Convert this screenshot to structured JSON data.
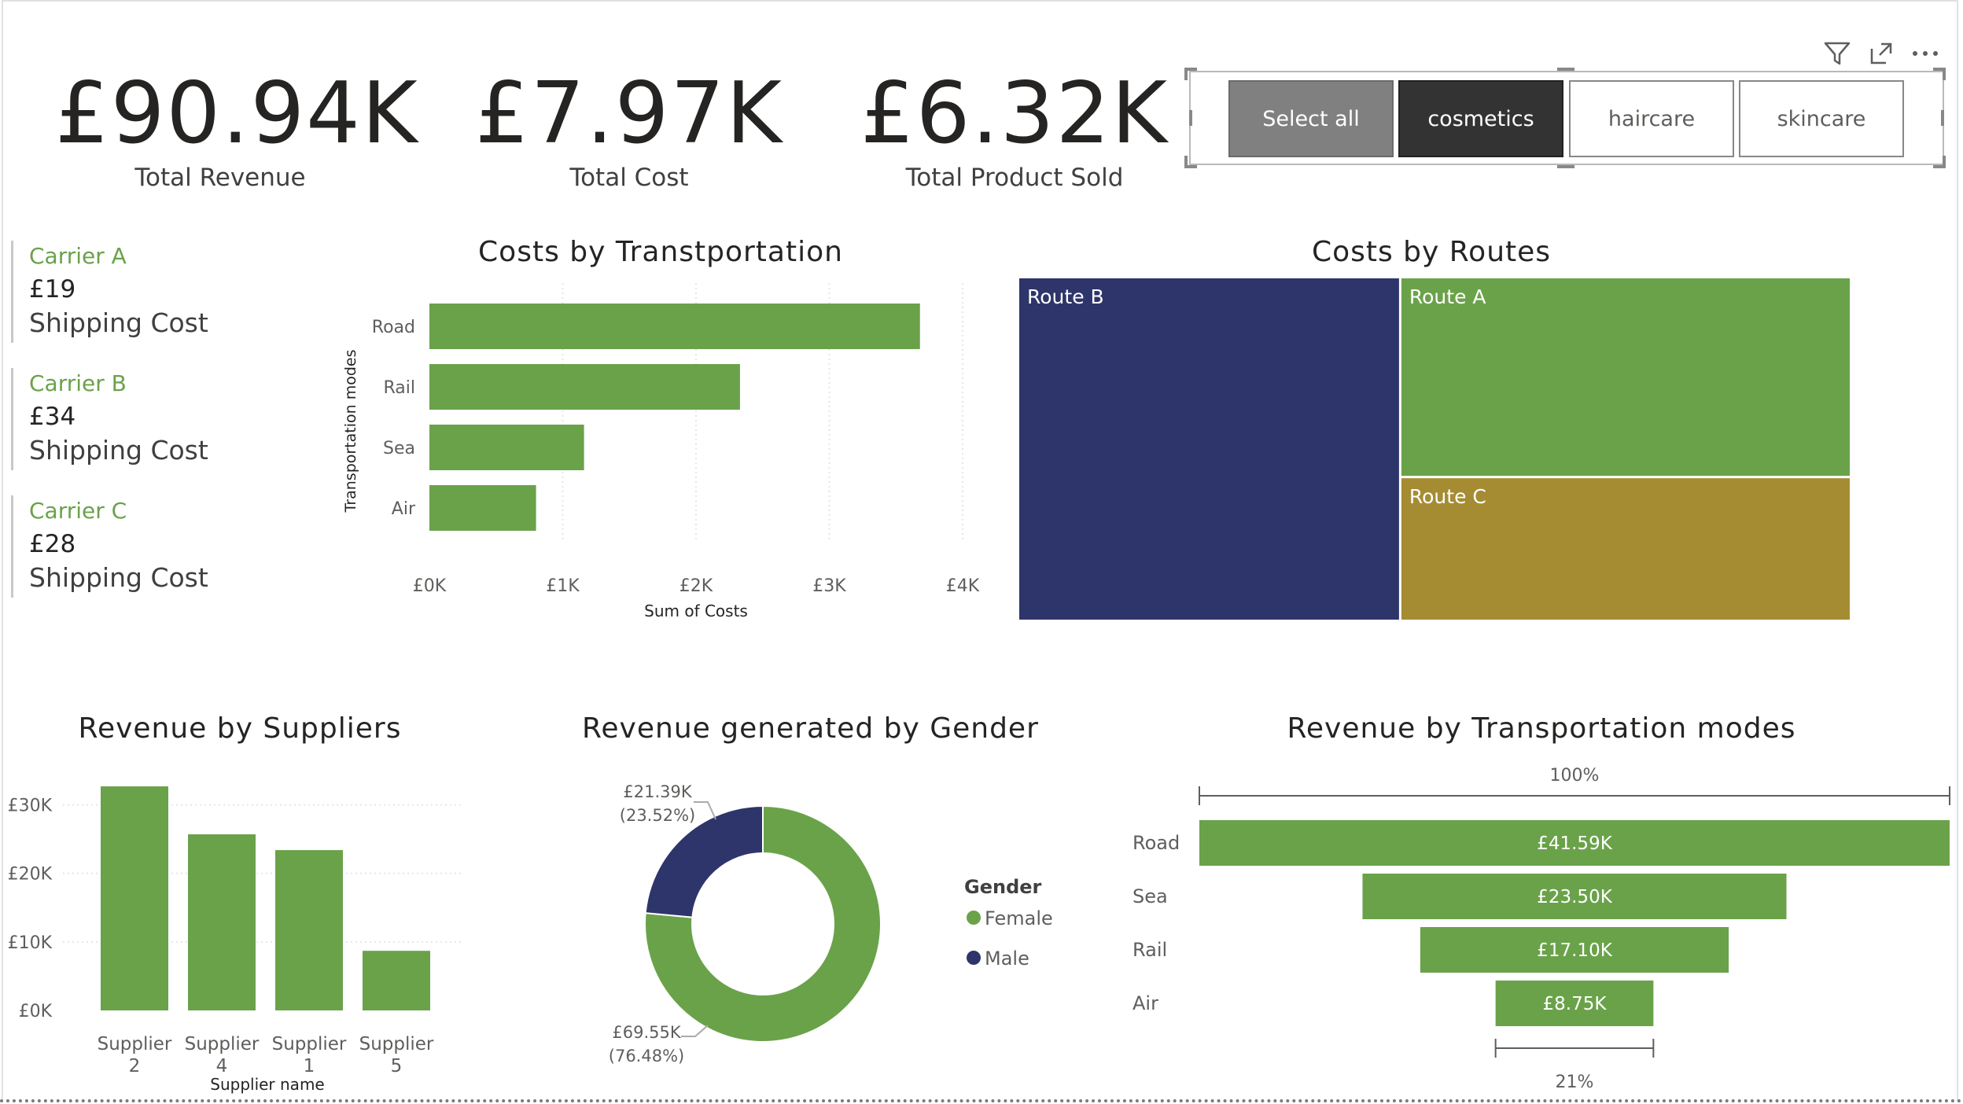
{
  "kpis": [
    {
      "value": "£90.94K",
      "label": "Total Revenue"
    },
    {
      "value": "£7.97K",
      "label": "Total Cost"
    },
    {
      "value": "£6.32K",
      "label": "Total Product Sold"
    }
  ],
  "slicer": {
    "options": [
      "Select all",
      "cosmetics",
      "haircare",
      "skincare"
    ],
    "selected": "cosmetics"
  },
  "header_icons": [
    "filter-icon",
    "focus-mode-icon",
    "more-options-icon"
  ],
  "carriers": [
    {
      "name": "Carrier A",
      "cost": "£19",
      "label": "Shipping Cost"
    },
    {
      "name": "Carrier B",
      "cost": "£34",
      "label": "Shipping Cost"
    },
    {
      "name": "Carrier C",
      "cost": "£28",
      "label": "Shipping Cost"
    }
  ],
  "colors": {
    "green": "#6aa24a",
    "navy": "#2e356b",
    "gold": "#a58c33",
    "text": "#252423"
  },
  "chart_data": [
    {
      "id": "costs-by-transportation",
      "type": "bar",
      "orientation": "horizontal",
      "title": "Costs by Transtportation",
      "xlabel": "Sum of Costs",
      "ylabel": "Transportation modes",
      "categories": [
        "Road",
        "Rail",
        "Sea",
        "Air"
      ],
      "values": [
        3680,
        2330,
        1160,
        800
      ],
      "xticks": [
        "£0K",
        "£1K",
        "£2K",
        "£3K",
        "£4K"
      ],
      "xlim": [
        0,
        4000
      ],
      "grid": true
    },
    {
      "id": "costs-by-routes",
      "type": "treemap",
      "title": "Costs by Routes",
      "categories": [
        "Route B",
        "Route A",
        "Route C"
      ],
      "values": [
        3640,
        2500,
        1820
      ]
    },
    {
      "id": "revenue-by-suppliers",
      "type": "bar",
      "title": "Revenue by Suppliers",
      "xlabel": "Supplier name",
      "categories": [
        "Supplier 2",
        "Supplier 4",
        "Supplier 1",
        "Supplier 5"
      ],
      "values": [
        32700,
        25700,
        23400,
        8700
      ],
      "yticks": [
        "£0K",
        "£10K",
        "£20K",
        "£30K"
      ],
      "ylim": [
        0,
        35000
      ]
    },
    {
      "id": "revenue-by-gender",
      "type": "pie",
      "donut": true,
      "title": "Revenue generated by Gender",
      "legend_title": "Gender",
      "legend_position": "right",
      "series": [
        {
          "name": "Female",
          "value": 69550,
          "label": "£69.55K",
          "percent": "(76.48%)"
        },
        {
          "name": "Male",
          "value": 21390,
          "label": "£21.39K",
          "percent": "(23.52%)"
        }
      ]
    },
    {
      "id": "revenue-by-transportation-modes",
      "type": "funnel",
      "title": "Revenue by Transportation modes",
      "categories": [
        "Road",
        "Sea",
        "Rail",
        "Air"
      ],
      "values": [
        41590,
        23500,
        17100,
        8750
      ],
      "labels": [
        "£41.59K",
        "£23.50K",
        "£17.10K",
        "£8.75K"
      ],
      "top_percent": "100%",
      "bottom_percent": "21%"
    }
  ]
}
